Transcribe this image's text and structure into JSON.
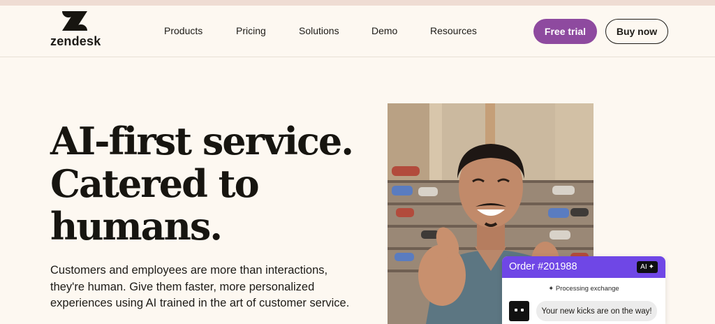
{
  "brand": {
    "name": "zendesk",
    "logo_icon": "zendesk-z-logo"
  },
  "nav": {
    "items": [
      {
        "label": "Products"
      },
      {
        "label": "Pricing"
      },
      {
        "label": "Solutions"
      },
      {
        "label": "Demo"
      },
      {
        "label": "Resources"
      }
    ],
    "free_trial_label": "Free trial",
    "buy_now_label": "Buy now"
  },
  "hero": {
    "headline_lines": [
      "AI-first service.",
      "Catered to",
      "humans."
    ],
    "subtext_lines": [
      "Customers and employees are more than interactions,",
      "they're human. Give them faster, more personalized",
      "experiences using AI trained in the art of customer service."
    ]
  },
  "chat_card": {
    "order_title": "Order #201988",
    "ai_badge": "AI",
    "status": "Processing exchange",
    "message": "Your new kicks are on the way!"
  },
  "colors": {
    "background": "#fdf8f1",
    "accent_purple": "#8e4a9f",
    "card_header": "#6f47e6",
    "top_strip": "#efdcd3"
  }
}
